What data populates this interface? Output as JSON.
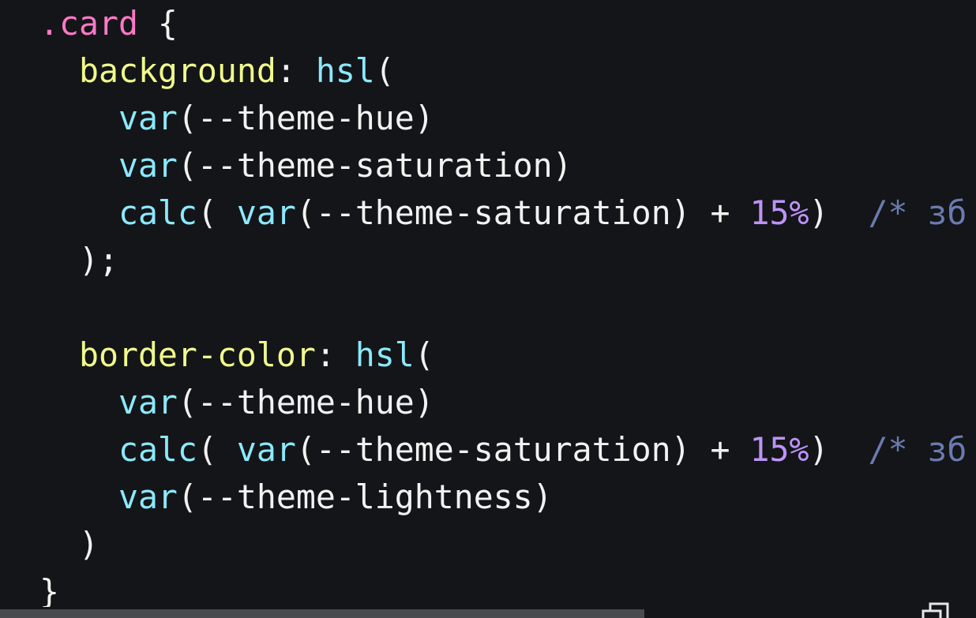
{
  "code": {
    "language": "css",
    "lines": [
      [
        {
          "t": ".card",
          "c": "sel"
        },
        {
          "t": " {",
          "c": "pun"
        }
      ],
      [
        {
          "t": "  ",
          "c": "pun"
        },
        {
          "t": "background",
          "c": "prop"
        },
        {
          "t": ": ",
          "c": "pun"
        },
        {
          "t": "hsl",
          "c": "fn"
        },
        {
          "t": "(",
          "c": "pun"
        }
      ],
      [
        {
          "t": "    ",
          "c": "pun"
        },
        {
          "t": "var",
          "c": "fn"
        },
        {
          "t": "(--theme-hue)",
          "c": "pun"
        }
      ],
      [
        {
          "t": "    ",
          "c": "pun"
        },
        {
          "t": "var",
          "c": "fn"
        },
        {
          "t": "(--theme-saturation)",
          "c": "pun"
        }
      ],
      [
        {
          "t": "    ",
          "c": "pun"
        },
        {
          "t": "calc",
          "c": "fn"
        },
        {
          "t": "( ",
          "c": "pun"
        },
        {
          "t": "var",
          "c": "fn"
        },
        {
          "t": "(--theme-saturation) + ",
          "c": "pun"
        },
        {
          "t": "15%",
          "c": "num"
        },
        {
          "t": ")  ",
          "c": "pun"
        },
        {
          "t": "/* зб",
          "c": "cmt"
        }
      ],
      [
        {
          "t": "  );",
          "c": "pun"
        }
      ],
      [],
      [
        {
          "t": "  ",
          "c": "pun"
        },
        {
          "t": "border-color",
          "c": "prop"
        },
        {
          "t": ": ",
          "c": "pun"
        },
        {
          "t": "hsl",
          "c": "fn"
        },
        {
          "t": "(",
          "c": "pun"
        }
      ],
      [
        {
          "t": "    ",
          "c": "pun"
        },
        {
          "t": "var",
          "c": "fn"
        },
        {
          "t": "(--theme-hue)",
          "c": "pun"
        }
      ],
      [
        {
          "t": "    ",
          "c": "pun"
        },
        {
          "t": "calc",
          "c": "fn"
        },
        {
          "t": "( ",
          "c": "pun"
        },
        {
          "t": "var",
          "c": "fn"
        },
        {
          "t": "(--theme-saturation) + ",
          "c": "pun"
        },
        {
          "t": "15%",
          "c": "num"
        },
        {
          "t": ")  ",
          "c": "pun"
        },
        {
          "t": "/* зб",
          "c": "cmt"
        }
      ],
      [
        {
          "t": "    ",
          "c": "pun"
        },
        {
          "t": "var",
          "c": "fn"
        },
        {
          "t": "(--theme-lightness)",
          "c": "pun"
        }
      ],
      [
        {
          "t": "  )",
          "c": "pun"
        }
      ],
      [
        {
          "t": "}",
          "c": "pun"
        }
      ]
    ]
  },
  "scrollbar": {
    "horizontal_thumb_fraction": 0.66
  },
  "icons": {
    "copy": "copy-icon"
  },
  "colors": {
    "background": "#141518",
    "selector": "#ff79c6",
    "property": "#f1fa8c",
    "function": "#8be9fd",
    "number": "#bd93f9",
    "comment": "#6a7bb0",
    "text": "#f2f2f2",
    "scrollbar_thumb": "#4a4b4f"
  }
}
